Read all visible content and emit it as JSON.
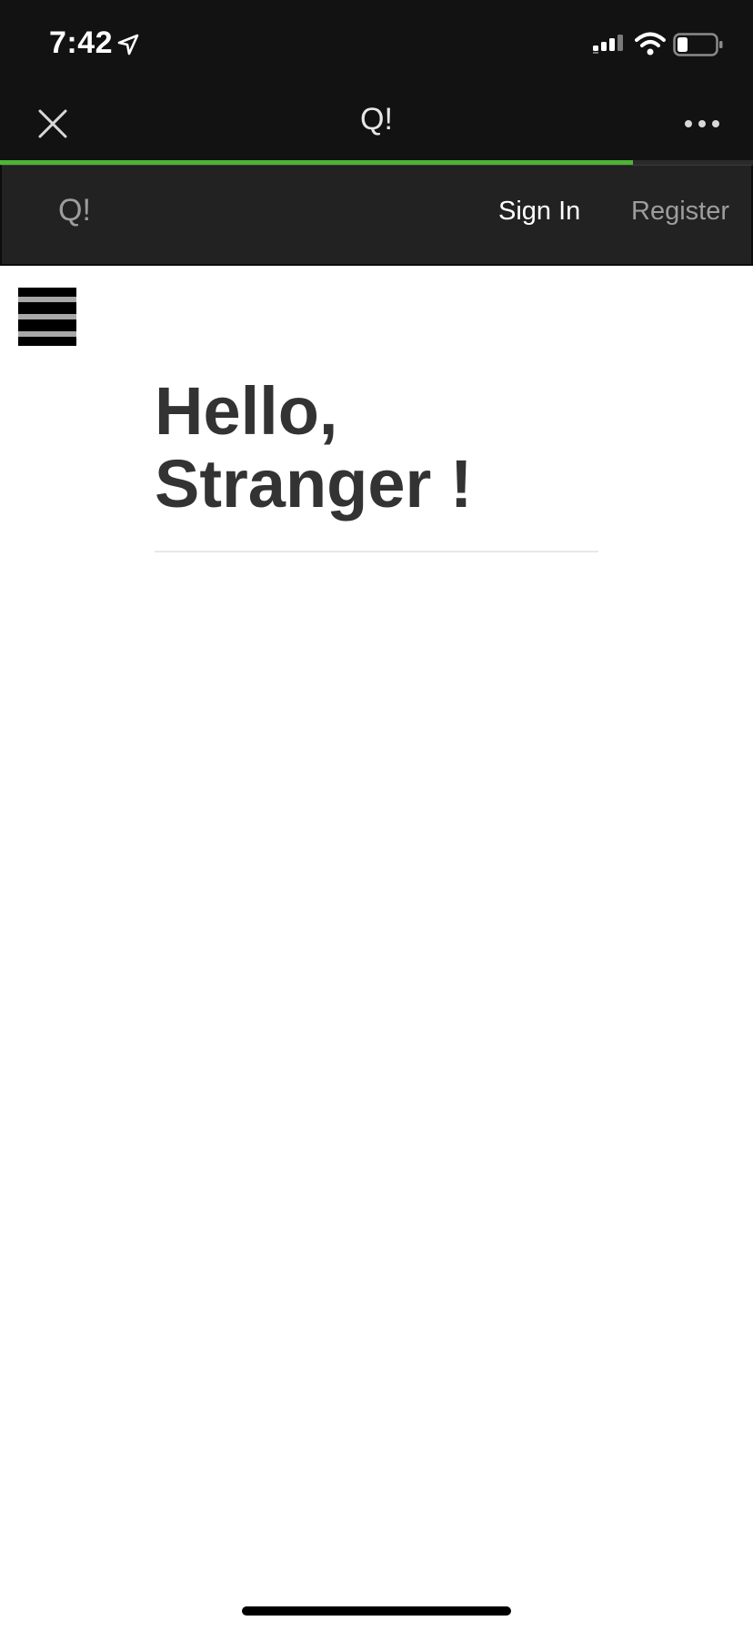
{
  "status_bar": {
    "time": "7:42",
    "icons": [
      "location-arrow-icon",
      "cellular-signal-icon",
      "wifi-icon",
      "battery-icon"
    ]
  },
  "browser": {
    "title": "Q!",
    "close_icon": "close-icon",
    "more_icon": "more-dots-icon",
    "load_progress": 0.84,
    "progress_color": "#4cb534"
  },
  "navbar": {
    "brand": "Q!",
    "signin_label": "Sign In",
    "register_label": "Register"
  },
  "menu": {
    "icon": "hamburger-menu-icon"
  },
  "main": {
    "greeting_line1": "Hello,",
    "greeting_line2": "Stranger !"
  },
  "colors": {
    "status_bg": "#121212",
    "navbar_bg": "#222222",
    "heading_text": "#333333",
    "muted_nav_text": "#9d9d9d"
  }
}
